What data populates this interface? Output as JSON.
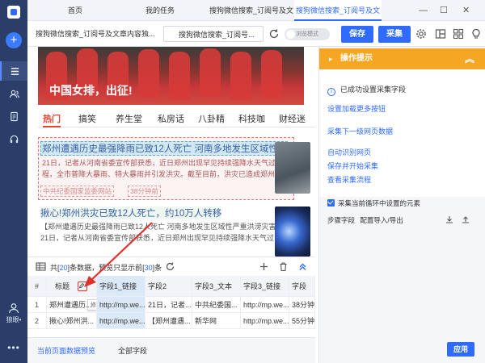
{
  "colors": {
    "accent": "#2f6bff",
    "rail": "#2b3e6a",
    "tip_header": "#f5a623",
    "highlight_red": "#e6432f"
  },
  "sidebar": {
    "user_label": "狼眼•",
    "icons": [
      "plus-icon",
      "menu-icon",
      "users-icon",
      "document-icon",
      "headset-icon",
      "avatar-icon",
      "more-icon"
    ]
  },
  "tabs": [
    {
      "label": "首页"
    },
    {
      "label": "我的任务"
    },
    {
      "label": "搜狗微信搜索_订阅号及文"
    },
    {
      "label": "搜狗微信搜索_订阅号及文"
    }
  ],
  "toolbar": {
    "page_title": "搜狗微信搜索_订阅号及文章内容独...",
    "url_title": "搜狗微信搜索_订阅号...",
    "browse_mode": "浏览模式",
    "save_label": "保存",
    "collect_label": "采集"
  },
  "webpage": {
    "banner_caption": "中国女排，出征!",
    "channels": [
      "热门",
      "搞笑",
      "养生堂",
      "私房话",
      "八卦精",
      "科技咖",
      "财经迷"
    ],
    "news": [
      {
        "title": "郑州遭遇历史最强降雨已致12人死亡 河南多地发生区域性...",
        "body": "21日，记者从河南省委宣传部获悉，近日郑州出现罕见持续强降水天气过程，全市普降大暴雨、特大暴雨并引发洪灾。截至目前，洪灾已造成郑州市区",
        "source": "中共纪委国家监委网站",
        "count": "38分钟前"
      },
      {
        "title": "揪心!郑州洪灾已致12人死亡，约10万人转移",
        "body": "【郑州遭遇历史最强降雨已致12人死亡 河南多地发生区域性严重洪涝灾害】21日，记者从河南省委宣传部获悉，近日郑州出现罕见持续强降水天气过"
      }
    ]
  },
  "tip_panel": {
    "title": "操作提示",
    "success": "已成功设置采集字段",
    "links": [
      "设置加载更多按钮",
      "采集下一级网页数据",
      "自动识别网页",
      "保存并开始采集",
      "查看采集流程"
    ],
    "checkbox_label": "采集当前循环中设置的元素",
    "steps_label": "步骤字段",
    "steps_action": "配置导入/导出",
    "apply_label": "应用"
  },
  "data_preview": {
    "summary_prefix": "共",
    "total": "20",
    "summary_mid": "条数据，预览只显示前",
    "shown": "30",
    "summary_suffix": "条",
    "tooltip": "修改字段名称",
    "columns": [
      "#",
      "标题",
      "字段1_链接",
      "字段2",
      "字段3_文本",
      "字段3_链接",
      "字段"
    ],
    "rows": [
      [
        "1",
        "郑州遭遇历...",
        "http://mp.we...",
        "21日，记者...",
        "中共纪委国...",
        "http://mp.we...",
        "38分钟"
      ],
      [
        "2",
        "揪心!郑州洪...",
        "http://mp.we...",
        "【郑州遭遇...",
        "新华网",
        "http://mp.we...",
        "55分钟"
      ]
    ]
  },
  "bottom_tabs": [
    "当前页面数据预览",
    "全部字段"
  ]
}
